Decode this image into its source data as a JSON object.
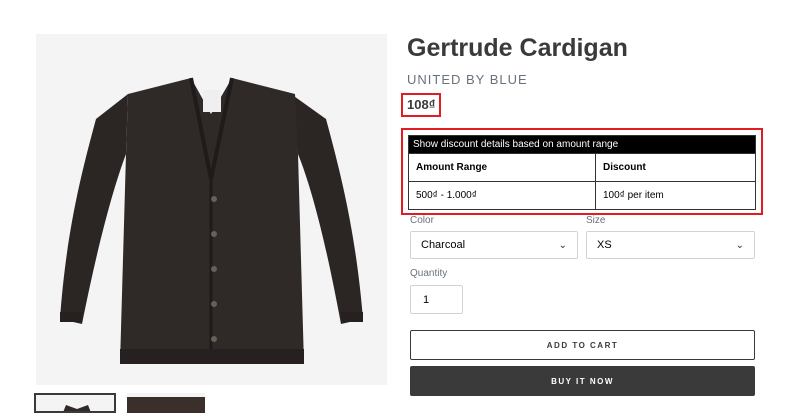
{
  "product": {
    "title": "Gertrude Cardigan",
    "vendor": "UNITED BY BLUE",
    "price": "108₫"
  },
  "discount": {
    "caption": "Show discount details based on amount range",
    "headers": [
      "Amount Range",
      "Discount"
    ],
    "rows": [
      {
        "range": "500₫ - 1.000₫",
        "discount": "100₫ per item"
      }
    ]
  },
  "options": {
    "color_label": "Color",
    "color_value": "Charcoal",
    "size_label": "Size",
    "size_value": "XS",
    "quantity_label": "Quantity",
    "quantity_value": "1"
  },
  "buttons": {
    "add_to_cart": "ADD TO CART",
    "buy_now": "BUY IT NOW"
  },
  "colors": {
    "highlight": "#e31b23",
    "button_dark": "#3a3a3a"
  },
  "icons": {
    "select_chevron": "chevron-down-icon"
  }
}
